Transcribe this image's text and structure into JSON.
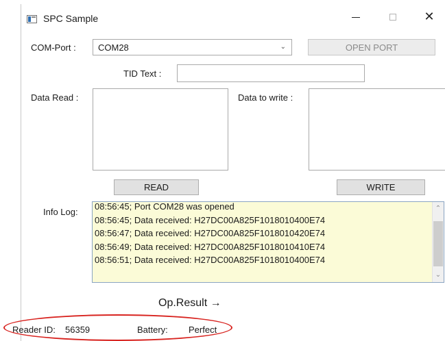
{
  "window": {
    "title": "SPC Sample",
    "controls": {
      "minimize": "—",
      "maximize": "☐",
      "close": "✕"
    }
  },
  "com_port": {
    "label": "COM-Port :",
    "selected": "COM28",
    "open_button": "OPEN PORT",
    "open_enabled": false
  },
  "tid": {
    "label": "TID Text :",
    "value": ""
  },
  "data_read": {
    "label": "Data Read :",
    "value": "",
    "button": "READ"
  },
  "data_write": {
    "label": "Data to write :",
    "value": "",
    "button": "WRITE"
  },
  "info_log": {
    "label": "Info Log:",
    "lines": [
      "08:56:45; Port COM28 was opened",
      "08:56:45; Data received: H27DC00A825F1018010400E74",
      "08:56:47; Data received: H27DC00A825F1018010420E74",
      "08:56:49; Data received: H27DC00A825F1018010410E74",
      "08:56:51; Data received: H27DC00A825F1018010400E74"
    ]
  },
  "op_result": {
    "label": "Op.Result →"
  },
  "status": {
    "reader_id_label": "Reader ID:",
    "reader_id_value": "56359",
    "battery_label": "Battery:",
    "battery_value": "Perfect"
  },
  "colors": {
    "log_background": "#fbfbd7",
    "highlight": "#d8231f"
  },
  "icons": {
    "app": "app-window-icon",
    "dropdown": "chevron-down-icon"
  }
}
